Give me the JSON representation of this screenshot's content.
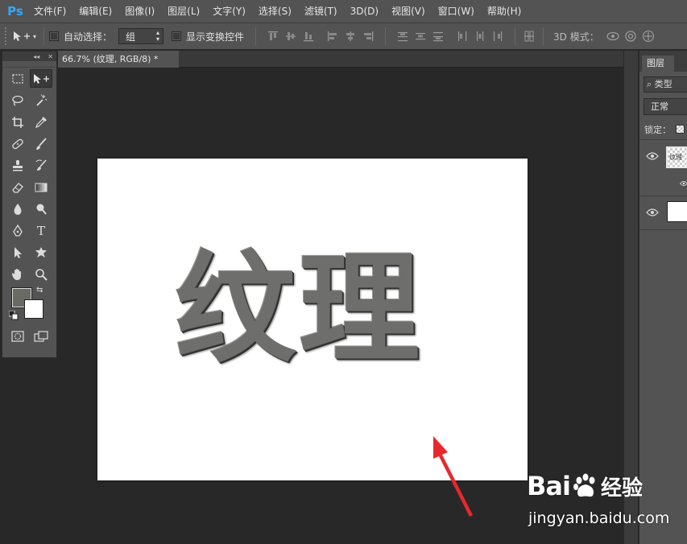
{
  "app": {
    "logo": "Ps"
  },
  "menu": [
    "文件(F)",
    "编辑(E)",
    "图像(I)",
    "图层(L)",
    "文字(Y)",
    "选择(S)",
    "滤镜(T)",
    "3D(D)",
    "视图(V)",
    "窗口(W)",
    "帮助(H)"
  ],
  "options": {
    "tool_icon": "move-tool-icon",
    "auto_select_label": "自动选择：",
    "auto_select_checked": false,
    "auto_select_value": "组",
    "show_transform_label": "显示变换控件",
    "show_transform_checked": false,
    "mode_3d_label": "3D 模式："
  },
  "document": {
    "tab_title": "66.7% (纹理, RGB/8) *",
    "canvas_text": "纹理"
  },
  "tools_panel": {
    "collapse_label": "◂◂",
    "close_label": "✕"
  },
  "colors": {
    "foreground": "#6a6a64",
    "background": "#ffffff",
    "accent": "#31a8ff",
    "arrow": "#e8282b"
  },
  "layers_panel": {
    "tab_label": "图层",
    "filter_label": "⌕ 类型",
    "blend_mode": "正常",
    "lock_label": "锁定：",
    "layers": [
      {
        "thumb_text": "纹理",
        "visible": true
      },
      {
        "thumb_text": "",
        "visible": true
      }
    ]
  },
  "watermark": {
    "brand_left": "Bai",
    "brand_right": "经验",
    "url": "jingyan.baidu.com"
  }
}
